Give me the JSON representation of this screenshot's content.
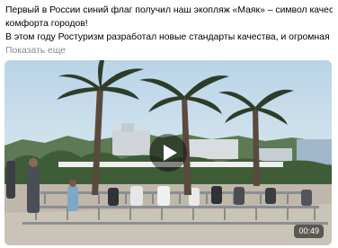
{
  "post": {
    "lines": [
      "Первый в России синий флаг получил наш экопляж «Маяк» – символ качества и",
      "комфорта городов!",
      "В этом году Ростуризм разработал новые стандарты качества, и огромная честь"
    ],
    "show_more_label": "Показать еще"
  },
  "video": {
    "duration": "00:49",
    "play_icon": "play-icon"
  },
  "colors": {
    "text": "#000000",
    "show_more": "#818c99",
    "sky": "#c9dde9"
  }
}
